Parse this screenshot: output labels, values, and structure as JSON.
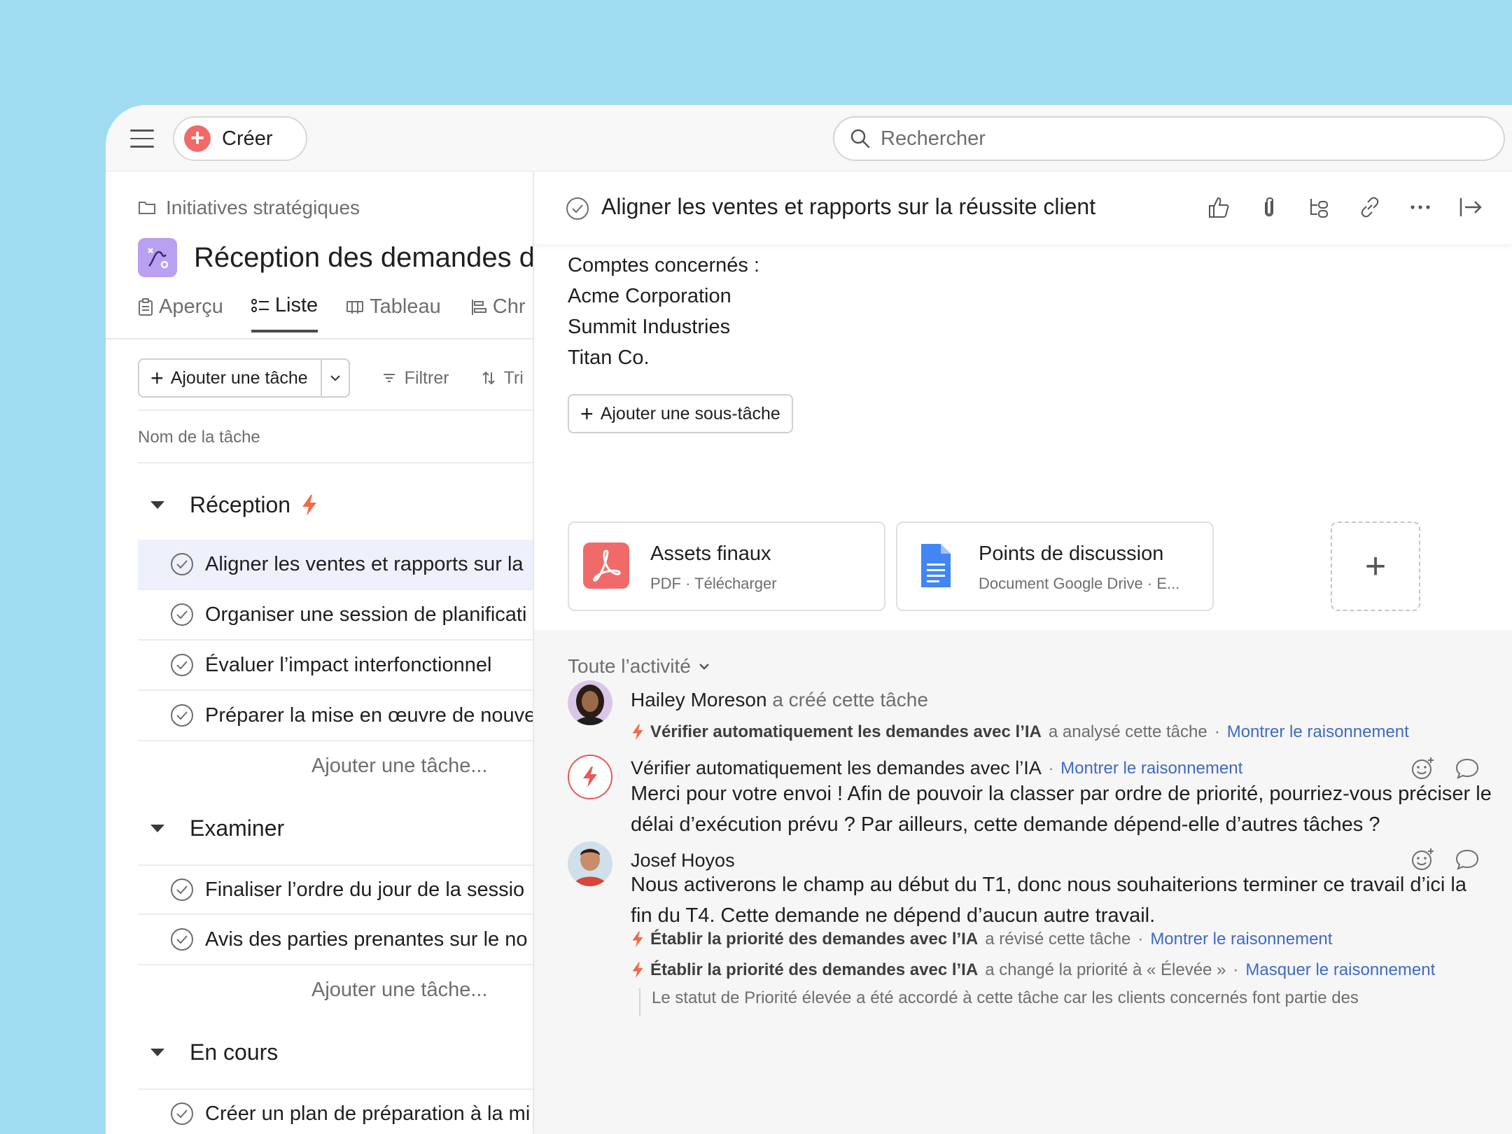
{
  "topbar": {
    "create_label": "Créer",
    "search_placeholder": "Rechercher"
  },
  "project": {
    "breadcrumb": "Initiatives stratégiques",
    "name": "Réception des demandes de",
    "tabs": [
      {
        "label": "Aperçu",
        "icon": "clipboard-icon"
      },
      {
        "label": "Liste",
        "icon": "list-icon",
        "active": true
      },
      {
        "label": "Tableau",
        "icon": "board-icon"
      },
      {
        "label": "Chr",
        "icon": "timeline-icon"
      }
    ]
  },
  "toolbar": {
    "add_task_label": "Ajouter une tâche",
    "filter_label": "Filtrer",
    "sort_label": "Tri"
  },
  "list": {
    "column_header": "Nom de la tâche",
    "add_task_row": "Ajouter une tâche...",
    "sections": [
      {
        "title": "Réception",
        "tasks": [
          "Aligner les ventes et rapports sur la",
          "Organiser une session de planificati",
          "Évaluer l’impact interfonctionnel",
          "Préparer la mise en œuvre de nouve"
        ]
      },
      {
        "title": "Examiner",
        "tasks": [
          "Finaliser l’ordre du jour de la sessio",
          "Avis des parties prenantes sur le no"
        ]
      },
      {
        "title": "En cours",
        "tasks": [
          "Créer un plan de préparation à la mi"
        ]
      }
    ]
  },
  "task": {
    "title": "Aligner les ventes et rapports sur la réussite client",
    "description": [
      "Comptes concernés :",
      "Acme Corporation",
      "Summit Industries",
      "Titan Co."
    ],
    "add_subtask_label": "Ajouter une sous-tâche",
    "attachments": [
      {
        "name": "Assets finaux",
        "meta": "PDF · Télécharger",
        "icon": "pdf-icon"
      },
      {
        "name": "Points de discussion",
        "meta": "Document Google Drive · E...",
        "icon": "google-doc-icon"
      }
    ]
  },
  "activity": {
    "filter_label": "Toute l’activité",
    "created": {
      "user": "Hailey Moreson",
      "action": "a créé cette tâche"
    },
    "sys1": {
      "agent": "Vérifier automatiquement les demandes avec l’IA",
      "action": "a analysé cette tâche",
      "link": "Montrer le raisonnement"
    },
    "comment1": {
      "author": "Vérifier automatiquement les demandes avec l’IA",
      "link": "Montrer le raisonnement",
      "text": "Merci pour votre envoi ! Afin de pouvoir la classer par ordre de priorité, pourriez-vous préciser le délai d’exécution prévu ? Par ailleurs, cette demande dépend-elle d’autres tâches ?"
    },
    "comment2": {
      "author": "Josef Hoyos",
      "text": "Nous activerons le champ au début du T1, donc nous souhaiterions terminer ce travail d’ici la fin du T4. Cette demande ne dépend d’aucun autre travail."
    },
    "sys2": {
      "agent": "Établir la priorité des demandes avec l’IA",
      "action": "a révisé cette tâche",
      "link": "Montrer le raisonnement"
    },
    "sys3": {
      "agent": "Établir la priorité des demandes avec l’IA",
      "action": "a changé la priorité à « Élevée »",
      "link": "Masquer le raisonnement"
    },
    "reasoning": "Le statut de Priorité élevée a été accordé à cette tâche car les clients concernés font partie des"
  },
  "colors": {
    "accent_red": "#f06a6a",
    "link_blue": "#3f6ac4",
    "selected_row": "#eef0fb"
  }
}
